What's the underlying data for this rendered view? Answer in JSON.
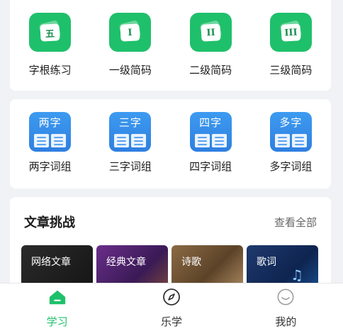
{
  "practice": {
    "items": [
      {
        "badge": "五",
        "label": "字根练习"
      },
      {
        "badge": "I",
        "label": "一级简码"
      },
      {
        "badge": "II",
        "label": "二级简码"
      },
      {
        "badge": "III",
        "label": "三级简码"
      }
    ]
  },
  "words": {
    "items": [
      {
        "icon_text": "两字",
        "label": "两字词组"
      },
      {
        "icon_text": "三字",
        "label": "三字词组"
      },
      {
        "icon_text": "四字",
        "label": "四字词组"
      },
      {
        "icon_text": "多字",
        "label": "多字词组"
      }
    ]
  },
  "articles": {
    "title": "文章挑战",
    "more": "查看全部",
    "tiles": [
      {
        "label": "网络文章"
      },
      {
        "label": "经典文章"
      },
      {
        "label": "诗歌"
      },
      {
        "label": "歌词"
      }
    ]
  },
  "tabbar": {
    "tabs": [
      {
        "label": "学习",
        "icon": "home-icon",
        "active": true
      },
      {
        "label": "乐学",
        "icon": "compass-icon",
        "active": false
      },
      {
        "label": "我的",
        "icon": "smiley-icon",
        "active": false
      }
    ]
  },
  "colors": {
    "accent_green": "#1fc06b",
    "icon_blue": "#2f7fe0",
    "background": "#f1f2f6"
  }
}
